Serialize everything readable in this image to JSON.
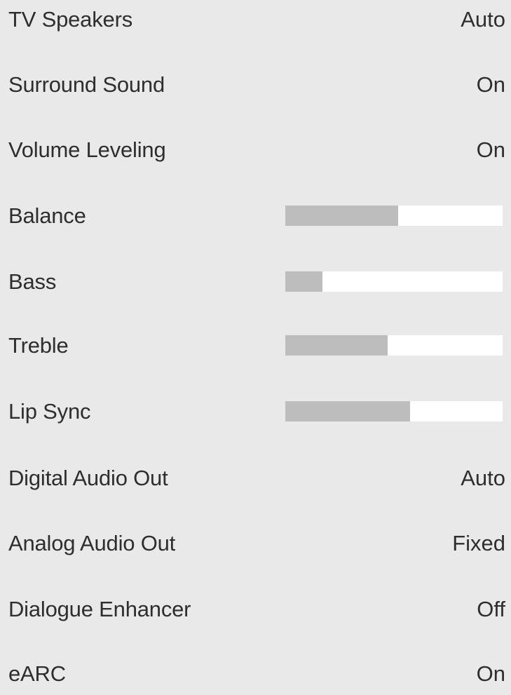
{
  "menu": {
    "items": [
      {
        "label": "TV Speakers",
        "value": "Auto"
      },
      {
        "label": "Surround Sound",
        "value": "On"
      },
      {
        "label": "Volume Leveling",
        "value": "On"
      },
      {
        "label": "Balance",
        "level": 0.52
      },
      {
        "label": "Bass",
        "level": 0.17
      },
      {
        "label": "Treble",
        "level": 0.47
      },
      {
        "label": "Lip Sync",
        "level": 0.575
      },
      {
        "label": "Digital Audio Out",
        "value": "Auto"
      },
      {
        "label": "Analog Audio Out",
        "value": "Fixed"
      },
      {
        "label": "Dialogue Enhancer",
        "value": "Off"
      },
      {
        "label": "eARC",
        "value": "On"
      }
    ]
  }
}
